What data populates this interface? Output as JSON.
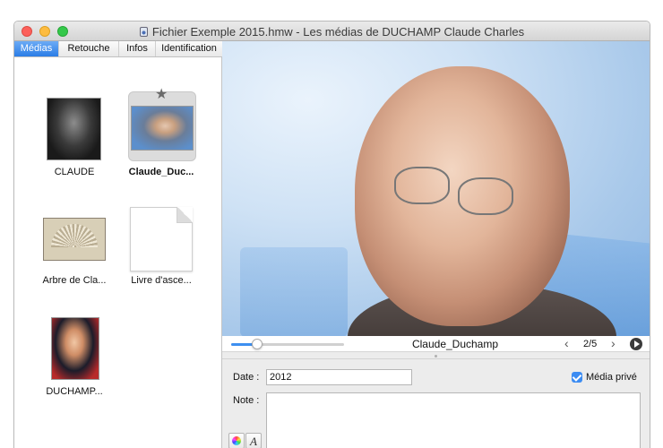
{
  "window": {
    "title": "Fichier Exemple 2015.hmw - Les médias de DUCHAMP Claude Charles"
  },
  "tabs": [
    {
      "label": "Médias",
      "active": true
    },
    {
      "label": "Retouche",
      "active": false
    },
    {
      "label": "Infos",
      "active": false
    },
    {
      "label": "Identification",
      "active": false
    }
  ],
  "media_items": [
    {
      "label": "CLAUDE",
      "type": "photo",
      "selected": false
    },
    {
      "label": "Claude_Duc...",
      "type": "photo",
      "selected": true,
      "starred": true
    },
    {
      "label": "Arbre de Cla...",
      "type": "photo",
      "selected": false
    },
    {
      "label": "Livre d'asce...",
      "type": "document",
      "selected": false
    },
    {
      "label": "DUCHAMP...",
      "type": "photo",
      "selected": false
    }
  ],
  "viewer": {
    "media_name": "Claude_Duchamp",
    "counter": "2/5",
    "prev_icon": "chevron-left-icon",
    "next_icon": "chevron-right-icon",
    "play_icon": "play-icon",
    "zoom_level": 0.22
  },
  "form": {
    "date_label": "Date :",
    "date_value": "2012",
    "private_label": "Média privé",
    "private_checked": true,
    "note_label": "Note :",
    "note_value": ""
  },
  "colors": {
    "accent": "#3c8cf2",
    "tab_active": "#2b7de6",
    "close": "#fc605b",
    "minimize": "#fdbc40",
    "zoom": "#34c84a"
  }
}
